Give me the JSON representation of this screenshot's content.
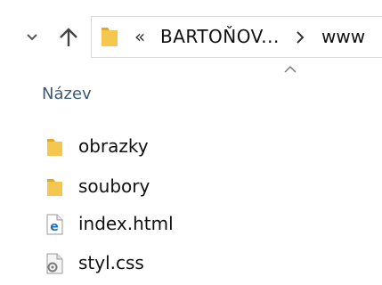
{
  "toolbar": {
    "recent_locations_icon": "chevron-down-icon",
    "up_icon": "arrow-up-icon"
  },
  "address_bar": {
    "folder_icon": "folder-icon",
    "overflow": "«",
    "crumbs": [
      "BARTOŇOV...",
      "www"
    ],
    "separator_icon": "chevron-right-icon"
  },
  "columns": {
    "name_header": "Název",
    "sort_icon": "sort-ascending-icon"
  },
  "files": [
    {
      "name": "obrazky",
      "icon": "folder-icon"
    },
    {
      "name": "soubory",
      "icon": "folder-icon"
    },
    {
      "name": "index.html",
      "icon": "edge-html-icon"
    },
    {
      "name": "styl.css",
      "icon": "css-file-icon"
    }
  ],
  "colors": {
    "folder": "#f6c74e",
    "folder_dark": "#e5a823",
    "header_text": "#3c5a78",
    "edge_blue": "#1a73c8"
  }
}
